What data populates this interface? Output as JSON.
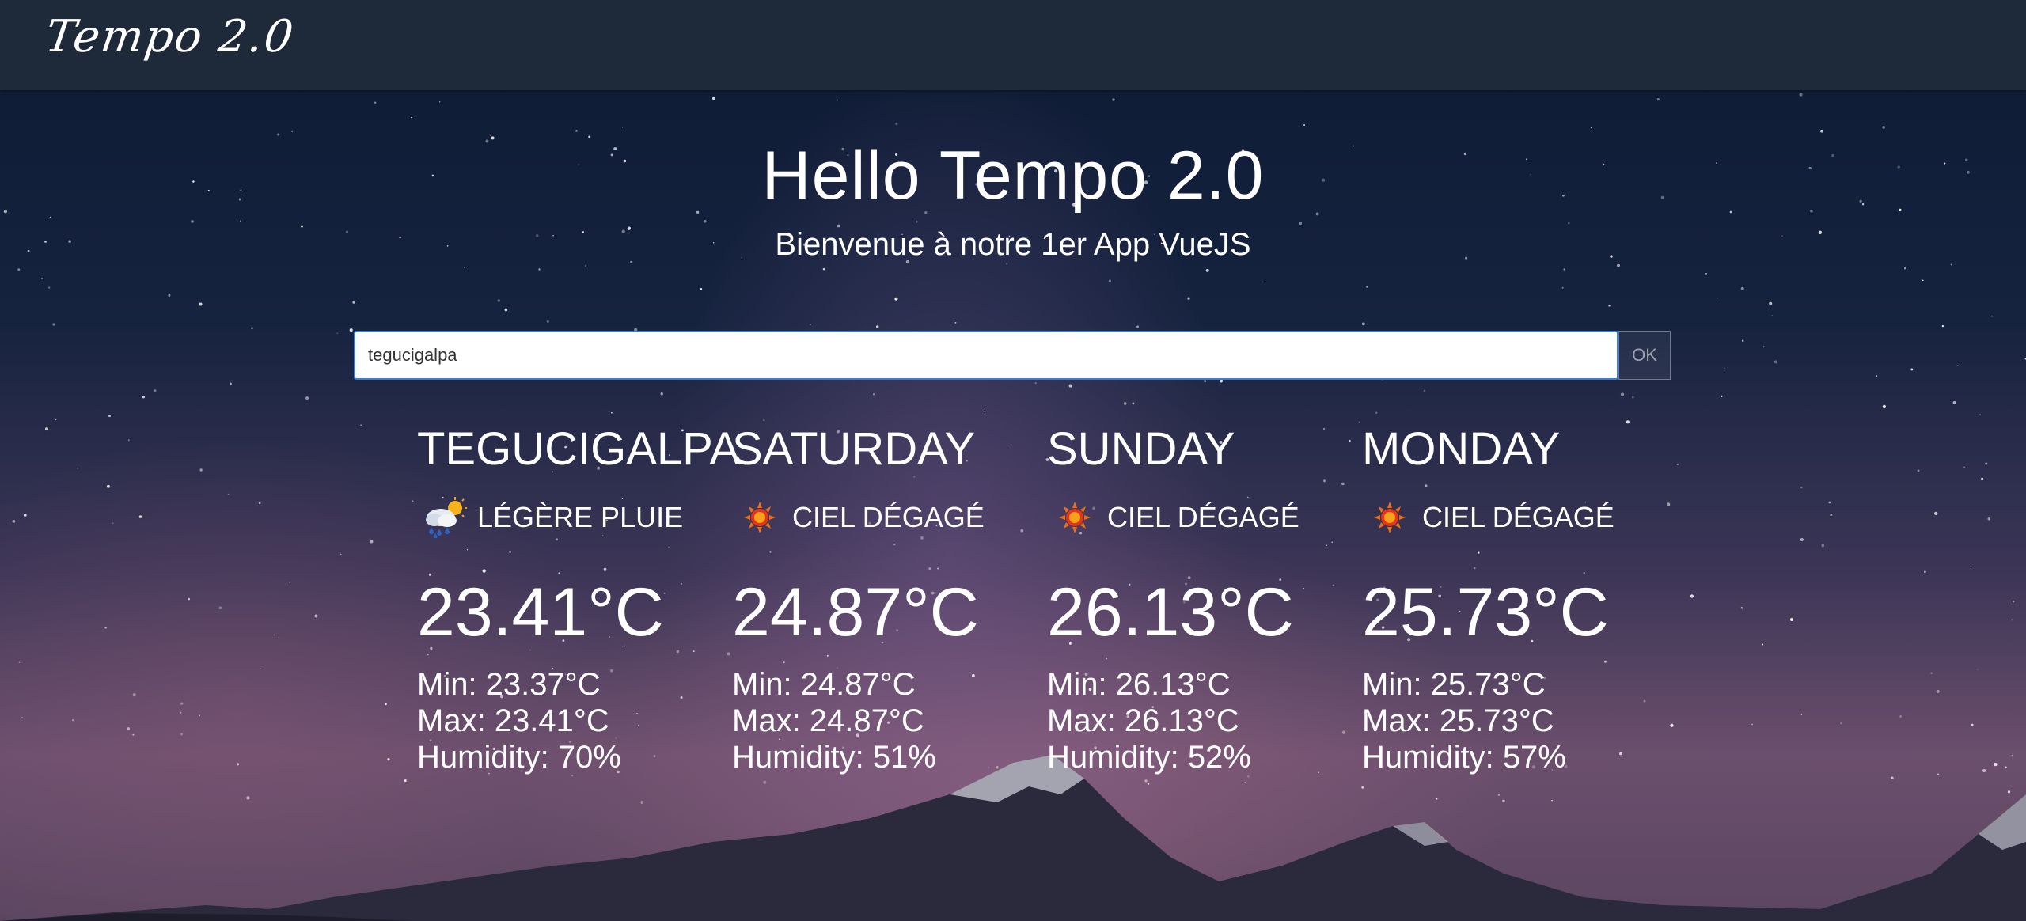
{
  "navbar": {
    "brand": "Tempo 2.0"
  },
  "hero": {
    "title": "Hello Tempo 2.0",
    "subtitle": "Bienvenue à notre 1er App VueJS"
  },
  "search": {
    "value": "tegucigalpa",
    "button_label": "OK"
  },
  "forecast": [
    {
      "name": "TEGUCIGALPA",
      "icon": "light-rain-icon",
      "condition": "LÉGÈRE PLUIE",
      "temp": "23.41°C",
      "min": "Min: 23.37°C",
      "max": "Max: 23.41°C",
      "humidity": "Humidity: 70%"
    },
    {
      "name": "SATURDAY",
      "icon": "sun-icon",
      "condition": "CIEL DÉGAGÉ",
      "temp": "24.87°C",
      "min": "Min: 24.87°C",
      "max": "Max: 24.87°C",
      "humidity": "Humidity: 51%"
    },
    {
      "name": "SUNDAY",
      "icon": "sun-icon",
      "condition": "CIEL DÉGAGÉ",
      "temp": "26.13°C",
      "min": "Min: 26.13°C",
      "max": "Max: 26.13°C",
      "humidity": "Humidity: 52%"
    },
    {
      "name": "MONDAY",
      "icon": "sun-icon",
      "condition": "CIEL DÉGAGÉ",
      "temp": "25.73°C",
      "min": "Min: 25.73°C",
      "max": "Max: 25.73°C",
      "humidity": "Humidity: 57%"
    }
  ],
  "colors": {
    "navbar": "#1e2a3a",
    "input_border": "#3a7bd5",
    "text": "#ffffff"
  }
}
